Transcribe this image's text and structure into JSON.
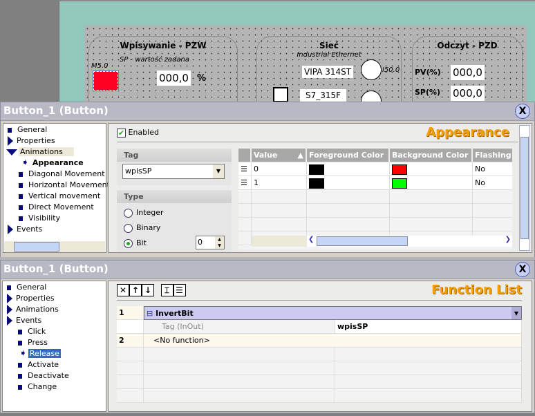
{
  "canvas": {
    "group1": {
      "title": "Wpisywanie - PZW",
      "subtitle": "SP - wartość zadana",
      "tag": "M5.0",
      "value": "000,0",
      "unit": "%"
    },
    "group2": {
      "title": "Sieć",
      "subtitle": "Industrial Ethernet",
      "device1": "VIPA 314ST",
      "device2": "S7_315F",
      "tag": "I50.0"
    },
    "group3": {
      "title": "Odczyt - PZD",
      "pv_label": "PV(%)",
      "pv_value": "000,0",
      "sp_label": "SP(%)",
      "sp_value": "000,0"
    }
  },
  "dialog1": {
    "title": "Button_1 (Button)",
    "tree": [
      "General",
      "Properties",
      "Animations",
      "Appearance",
      "Diagonal Movement",
      "Horizontal Movement",
      "Vertical movement",
      "Direct Movement",
      "Visibility",
      "Events"
    ],
    "selected": "Appearance",
    "enabled_label": "Enabled",
    "enabled": true,
    "heading": "Appearance",
    "tag_label": "Tag",
    "tag_value": "wpisSP",
    "type_label": "Type",
    "types": [
      "Integer",
      "Binary",
      "Bit"
    ],
    "selected_type": "Bit",
    "bit_value": "0",
    "columns": [
      "Value",
      "Foreground Color",
      "Background Color",
      "Flashing"
    ],
    "rows": [
      {
        "value": "0",
        "fg": "#000000",
        "bg": "#ff0000",
        "flashing": "No"
      },
      {
        "value": "1",
        "fg": "#000000",
        "bg": "#00ff00",
        "flashing": "No"
      }
    ]
  },
  "dialog2": {
    "title": "Button_1 (Button)",
    "tree": [
      "General",
      "Properties",
      "Animations",
      "Events",
      "Click",
      "Press",
      "Release",
      "Activate",
      "Deactivate",
      "Change"
    ],
    "selected": "Release",
    "heading": "Function List",
    "functions": [
      {
        "num": "1",
        "name": "InvertBit",
        "param_label": "Tag (InOut)",
        "param_value": "wpisSP"
      },
      {
        "num": "2",
        "name": "<No function>"
      }
    ]
  },
  "colors": {
    "accent": "#f5a000",
    "title_bar": "#b9b9c6",
    "selection": "#316ac5",
    "function_row": "#cccaf0"
  }
}
